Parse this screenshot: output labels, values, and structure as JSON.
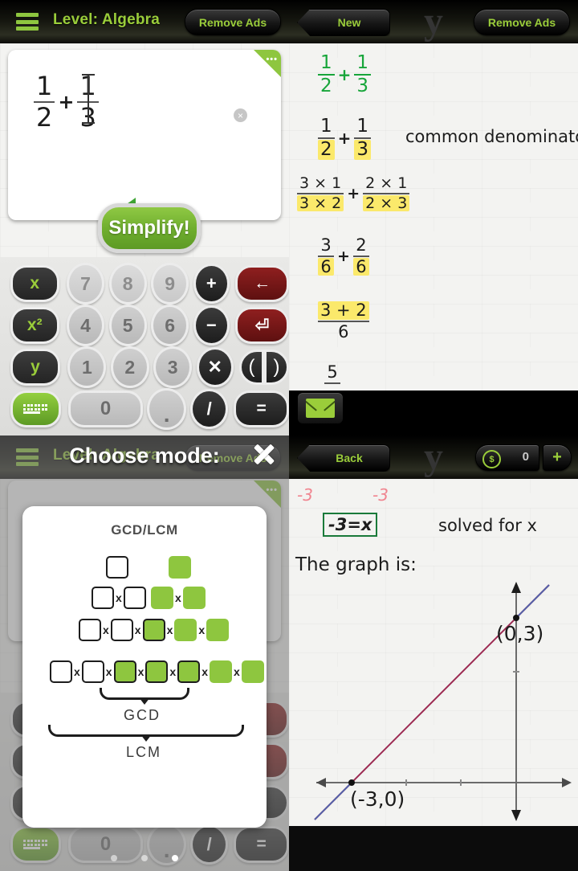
{
  "panels": {
    "top_left": {
      "header": {
        "menu_icon": "hamburger-icon",
        "title": "Level: Algebra",
        "remove_ads": "Remove Ads"
      },
      "input_card": {
        "expression": {
          "frac1": {
            "num": "1",
            "den": "2"
          },
          "operator": "+",
          "frac2": {
            "num": "1",
            "den": "3"
          }
        },
        "corner_icon": "•••",
        "clear_icon": "×",
        "play_icon": "play-triangle-icon",
        "action_button": "Simplify!"
      },
      "keypad": {
        "rows": [
          [
            "x",
            "7",
            "8",
            "9",
            "+",
            "←"
          ],
          [
            "x²",
            "4",
            "5",
            "6",
            "−",
            "⏎"
          ],
          [
            "y",
            "1",
            "2",
            "3",
            "×",
            "( )"
          ],
          [
            "keyboard-icon",
            "0",
            ".",
            "/",
            "="
          ]
        ]
      }
    },
    "top_right": {
      "header": {
        "new_button": "New",
        "logo": "y",
        "remove_ads": "Remove Ads"
      },
      "steps": [
        {
          "id": "step1",
          "style": "green",
          "frac1_num": "1",
          "frac1_den": "2",
          "op": "+",
          "frac2_num": "1",
          "frac2_den": "3",
          "note": ""
        },
        {
          "id": "step2",
          "style": "plain",
          "frac1_num": "1",
          "frac1_den": "2",
          "op": "+",
          "frac2_num": "1",
          "frac2_den": "3",
          "note": "common denominator"
        },
        {
          "id": "step3",
          "style": "plain",
          "frac1_num": "3 × 1",
          "frac1_den": "3 × 2",
          "op": "+",
          "frac2_num": "2 × 1",
          "frac2_den": "2 × 3",
          "note": ""
        },
        {
          "id": "step4",
          "style": "plain",
          "frac1_num": "3",
          "frac1_den": "6",
          "op": "+",
          "frac2_num": "2",
          "frac2_den": "6",
          "note": ""
        },
        {
          "id": "step5",
          "style": "plain",
          "frac1_num": "3 + 2",
          "frac1_den": "6",
          "op": "",
          "frac2_num": "",
          "frac2_den": "",
          "note": ""
        },
        {
          "id": "step6",
          "style": "plain",
          "frac1_num": "5",
          "frac1_den": "",
          "op": "",
          "frac2_num": "",
          "frac2_den": "",
          "note": ""
        }
      ],
      "mail_button": "envelope-icon"
    },
    "bottom_left": {
      "header": {
        "menu_icon": "hamburger-icon",
        "title": "Level: Algebra",
        "remove_ads": "Remove Ads"
      },
      "overlay": {
        "title": "Choose mode:",
        "close_icon": "×",
        "modal_title": "GCD/LCM",
        "rows": [
          {
            "left": [
              "w"
            ],
            "right": [
              "g"
            ]
          },
          {
            "left": [
              "w",
              "w"
            ],
            "right": [
              "g",
              "g"
            ]
          },
          {
            "left": [
              "w",
              "w",
              "go"
            ],
            "right": [
              "g",
              "g"
            ]
          },
          {
            "left": [
              "w",
              "w",
              "go",
              "go",
              "go"
            ],
            "right": [
              "g",
              "g"
            ]
          }
        ],
        "brace_labels": [
          "GCD",
          "LCM"
        ]
      },
      "keypad_visible": [
        "keyboard-icon",
        "0",
        ".",
        "/",
        "="
      ],
      "page_dots": 3
    },
    "bottom_right": {
      "header": {
        "back_button": "Back",
        "logo": "y",
        "coin_icon": "coin-icon",
        "coin_value": "0",
        "plus_button": "+"
      },
      "work": {
        "annot_left": "-3",
        "annot_right": "-3",
        "boxed_result": "-3=x",
        "note": "solved for x",
        "caption": "The graph is:"
      },
      "graph": {
        "points": [
          {
            "label": "(0,3)",
            "x": 0,
            "y": 3
          },
          {
            "label": "(-3,0)",
            "x": -3,
            "y": 0
          }
        ],
        "line_color": "#9c2a52",
        "axis_color": "#6b6b6b"
      }
    }
  },
  "colors": {
    "accent_green": "#9acd3a",
    "highlight_yellow": "#fbe96b",
    "pink": "#f08a96",
    "dark": "#111111"
  }
}
